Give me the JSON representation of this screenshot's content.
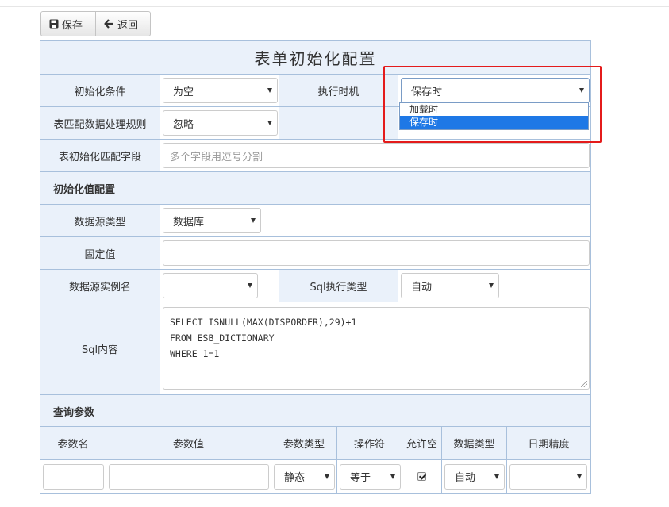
{
  "toolbar": {
    "save_label": "保存",
    "back_label": "返回"
  },
  "form": {
    "title": "表单初始化配置",
    "init_condition_label": "初始化条件",
    "init_condition_value": "为空",
    "exec_timing_label": "执行时机",
    "exec_timing_value": "保存时",
    "exec_timing_options": [
      "加载时",
      "保存时"
    ],
    "match_rule_label": "表匹配数据处理规则",
    "match_rule_value": "忽略",
    "match_field_label": "表初始化匹配字段",
    "match_field_placeholder": "多个字段用逗号分割"
  },
  "init_value_section": {
    "title": "初始化值配置",
    "datasource_type_label": "数据源类型",
    "datasource_type_value": "数据库",
    "fixed_value_label": "固定值",
    "fixed_value": "",
    "datasource_instance_label": "数据源实例名",
    "datasource_instance_value": "",
    "sql_exec_type_label": "Sql执行类型",
    "sql_exec_type_value": "自动",
    "sql_content_label": "Sql内容",
    "sql_lines": [
      "SELECT ISNULL(MAX(DISPORDER),29)+1",
      "FROM ESB_DICTIONARY",
      "WHERE 1=1"
    ]
  },
  "query_params": {
    "title": "查询参数",
    "columns": [
      "参数名",
      "参数值",
      "参数类型",
      "操作符",
      "允许空",
      "数据类型",
      "日期精度"
    ],
    "rows": [
      {
        "name": "",
        "value": "",
        "param_type": "静态",
        "operator": "等于",
        "allow_null": true,
        "data_type": "自动",
        "date_precision": ""
      }
    ]
  },
  "colors": {
    "header_bg": "#eaf1fa",
    "border": "#a8c0dc",
    "selected_option_bg": "#1e78e6",
    "highlight_border": "#e41b1b"
  }
}
